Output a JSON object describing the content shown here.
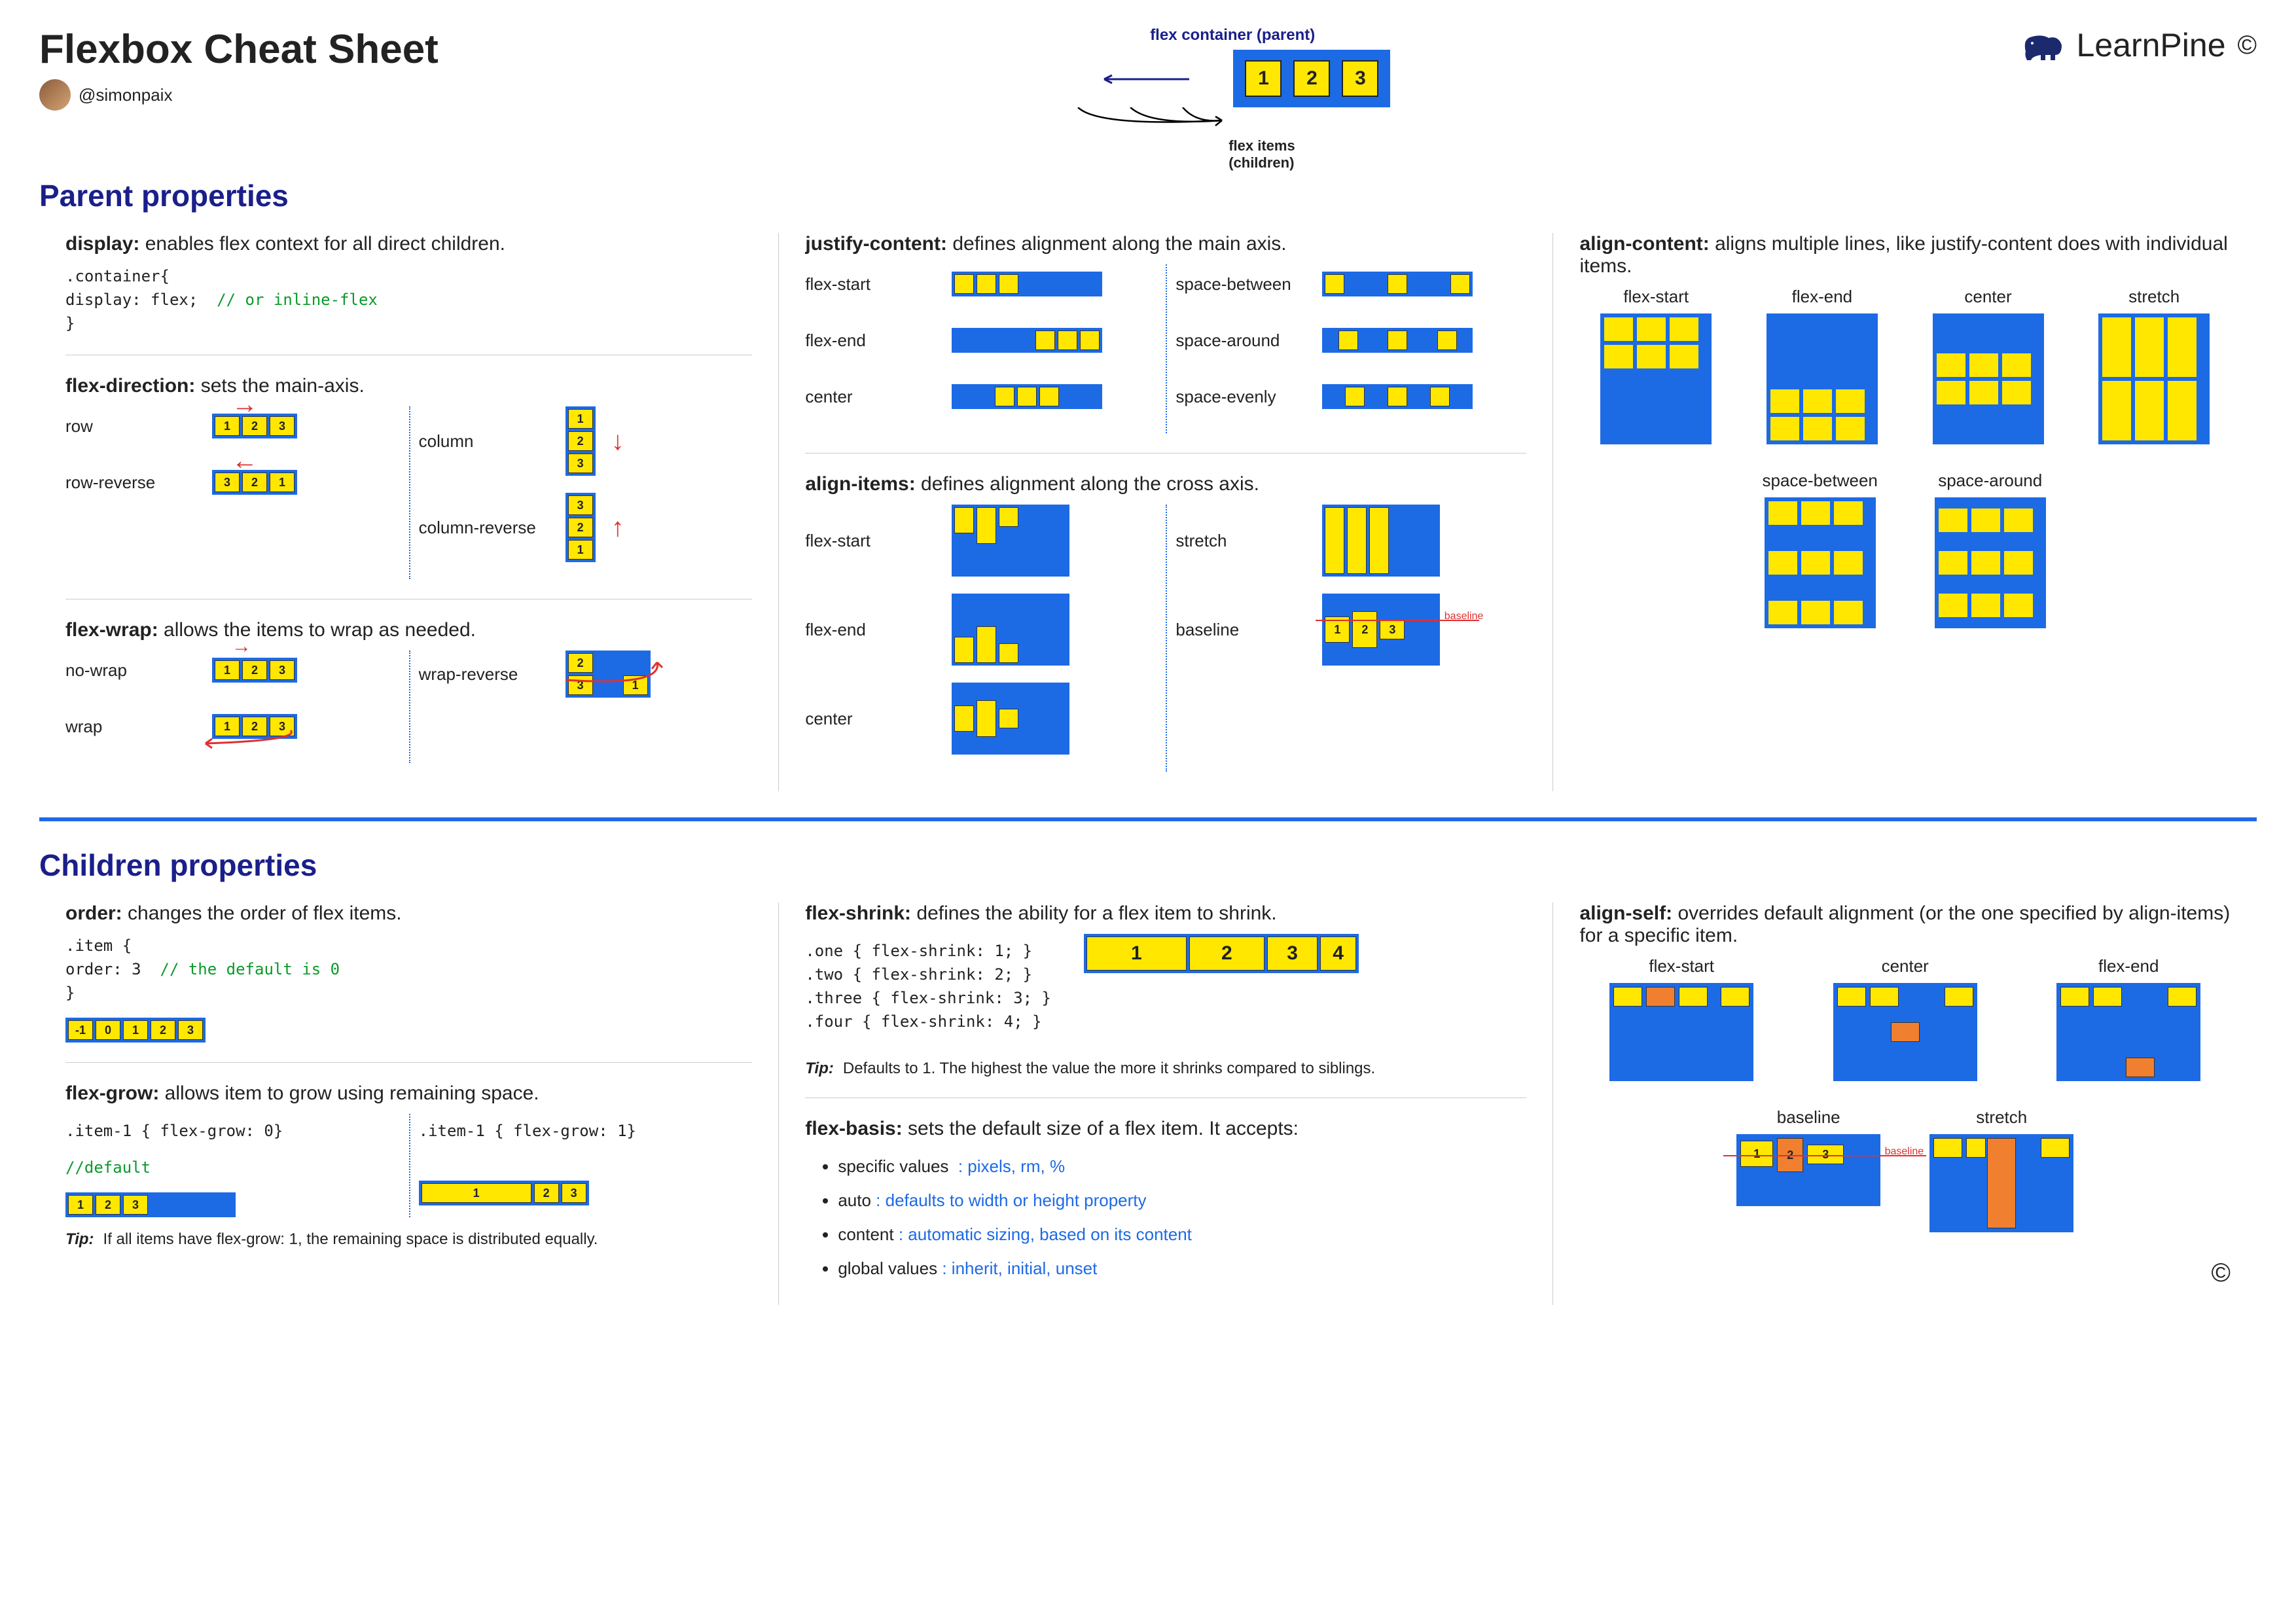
{
  "header": {
    "title": "Flexbox Cheat Sheet",
    "handle": "@simonpaix",
    "brand": "LearnPine",
    "copyright": "©",
    "hero_top_label": "flex container (parent)",
    "hero_items": [
      "1",
      "2",
      "3"
    ],
    "hero_bot_label_1": "flex items",
    "hero_bot_label_2": "(children)"
  },
  "parent": {
    "heading": "Parent properties",
    "display": {
      "title_b": "display:",
      "title_rest": " enables flex context for all direct children.",
      "code_l1": ".container{",
      "code_l2": "  display: flex;",
      "code_comment": "// or inline-flex",
      "code_l3": "}"
    },
    "flex_direction": {
      "title_b": "flex-direction:",
      "title_rest": " sets the main-axis.",
      "row": "row",
      "row_reverse": "row-reverse",
      "column": "column",
      "column_reverse": "column-reverse"
    },
    "flex_wrap": {
      "title_b": "flex-wrap:",
      "title_rest": " allows the items to wrap as needed.",
      "no_wrap": "no-wrap",
      "wrap": "wrap",
      "wrap_reverse": "wrap-reverse"
    },
    "justify_content": {
      "title_b": "justify-content:",
      "title_rest": " defines alignment along the main axis.",
      "flex_start": "flex-start",
      "flex_end": "flex-end",
      "center": "center",
      "space_between": "space-between",
      "space_around": "space-around",
      "space_evenly": "space-evenly"
    },
    "align_items": {
      "title_b": "align-items:",
      "title_rest": " defines alignment along the cross axis.",
      "flex_start": "flex-start",
      "flex_end": "flex-end",
      "center": "center",
      "stretch": "stretch",
      "baseline": "baseline",
      "baseline_label": "baseline"
    },
    "align_content": {
      "title_b": "align-content:",
      "title_rest": " aligns multiple lines, like justify-content does with individual items.",
      "flex_start": "flex-start",
      "flex_end": "flex-end",
      "center": "center",
      "stretch": "stretch",
      "space_between": "space-between",
      "space_around": "space-around"
    }
  },
  "children": {
    "heading": "Children properties",
    "order": {
      "title_b": "order:",
      "title_rest": " changes the order of flex items.",
      "code_l1": ".item {",
      "code_l2": "  order: 3",
      "code_comment": "// the default is 0",
      "code_l3": "}",
      "items": [
        "-1",
        "0",
        "1",
        "2",
        "3"
      ]
    },
    "flex_grow": {
      "title_b": "flex-grow:",
      "title_rest": " allows item to grow using remaining space.",
      "code_a": ".item-1 { flex-grow: 0}",
      "code_b": ".item-1 { flex-grow: 1}",
      "default": "//default",
      "tip_b": "Tip:",
      "tip": "If all items have flex-grow: 1, the remaining space is distributed equally."
    },
    "flex_shrink": {
      "title_b": "flex-shrink:",
      "title_rest": " defines the ability for a flex item to shrink.",
      "code_1": ".one { flex-shrink: 1; }",
      "code_2": ".two { flex-shrink: 2; }",
      "code_3": ".three { flex-shrink: 3; }",
      "code_4": ".four { flex-shrink: 4; }",
      "items": [
        "1",
        "2",
        "3",
        "4"
      ],
      "tip_b": "Tip:",
      "tip": "Defaults to 1. The highest the value the more it shrinks compared to siblings."
    },
    "flex_basis": {
      "title_b": "flex-basis:",
      "title_rest": " sets the default size of a flex item. It accepts:",
      "b1_a": "specific values",
      "b1_b": ": pixels, rm, %",
      "b2_a": "auto",
      "b2_b": ": defaults to width or height property",
      "b3_a": "content",
      "b3_b": ": automatic sizing, based on its content",
      "b4_a": "global values",
      "b4_b": ": inherit, initial, unset"
    },
    "align_self": {
      "title_b": "align-self:",
      "title_rest": " overrides default alignment (or the one specified by align-items) for a specific item.",
      "flex_start": "flex-start",
      "center": "center",
      "flex_end": "flex-end",
      "baseline": "baseline",
      "baseline_label": "baseline",
      "stretch": "stretch"
    }
  }
}
